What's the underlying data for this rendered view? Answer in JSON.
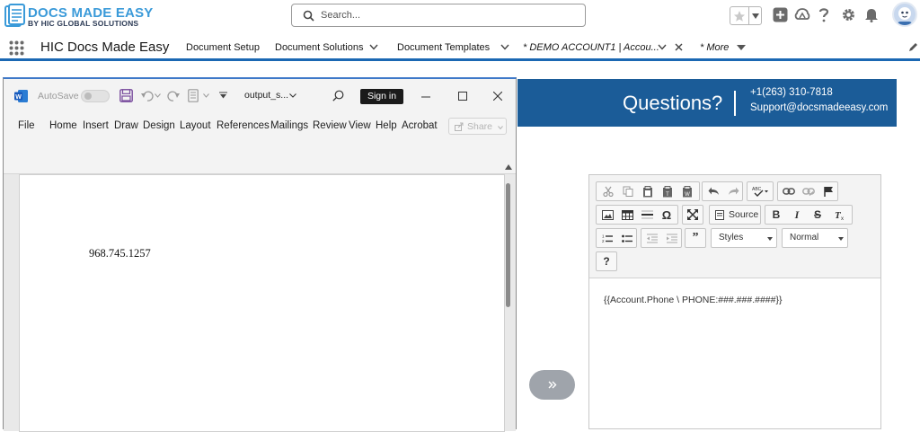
{
  "header": {
    "logo_title": "DOCS MADE EASY",
    "logo_subtitle": "BY HIC GLOBAL SOLUTIONS",
    "search_placeholder": "Search...",
    "icons": [
      "favorites-star-icon",
      "favorites-list-icon",
      "global-actions-add-icon",
      "trailhead-icon",
      "help-icon",
      "setup-gear-icon",
      "notifications-bell-icon",
      "user-avatar"
    ]
  },
  "nav": {
    "app_name": "HIC Docs Made Easy",
    "items": [
      {
        "label": "Document Setup"
      },
      {
        "label": "Document Solutions"
      },
      {
        "label": "Document Templates"
      },
      {
        "label": "* DEMO ACCOUNT1 | Accou..."
      },
      {
        "label": "* More"
      }
    ]
  },
  "banner": {
    "question": "Questions?",
    "phone": "+1(263) 310-7818",
    "email": "Support@docsmadeeasy.com"
  },
  "word": {
    "autosave_label": "AutoSave",
    "autosave_state": "off",
    "file_name": "output_s...",
    "sign_in_label": "Sign in",
    "share_label": "Share",
    "tabs": [
      "File",
      "Home",
      "Insert",
      "Draw",
      "Design",
      "Layout",
      "References",
      "Mailings",
      "Review",
      "View",
      "Help",
      "Acrobat"
    ],
    "document_text": "968.745.1257"
  },
  "editor": {
    "source_label": "Source",
    "styles_label": "Styles",
    "format_label": "Normal",
    "help_label": "?",
    "content": "{{Account.Phone \\ PHONE:###.###.####}}"
  },
  "colors": {
    "brand_blue": "#1b5c98",
    "nav_accent": "#1b68b3",
    "logo_blue": "#3a9ad9"
  }
}
